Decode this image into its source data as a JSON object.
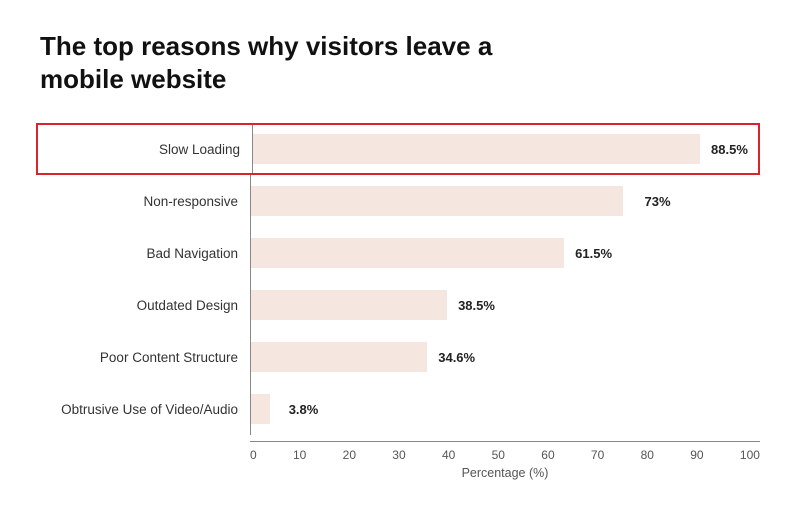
{
  "title": "The top reasons why visitors leave a mobile website",
  "bars": [
    {
      "label": "Slow Loading",
      "value": 88.5,
      "display": "88.5%",
      "highlighted": true
    },
    {
      "label": "Non-responsive",
      "value": 73,
      "display": "73%",
      "highlighted": false
    },
    {
      "label": "Bad Navigation",
      "value": 61.5,
      "display": "61.5%",
      "highlighted": false
    },
    {
      "label": "Outdated Design",
      "value": 38.5,
      "display": "38.5%",
      "highlighted": false
    },
    {
      "label": "Poor Content Structure",
      "value": 34.6,
      "display": "34.6%",
      "highlighted": false
    },
    {
      "label": "Obtrusive Use of Video/Audio",
      "value": 3.8,
      "display": "3.8%",
      "highlighted": false
    }
  ],
  "xAxis": {
    "ticks": [
      "0",
      "10",
      "20",
      "30",
      "40",
      "50",
      "60",
      "70",
      "80",
      "90",
      "100"
    ],
    "title": "Percentage (%)"
  },
  "colors": {
    "bar": "#f5e6df",
    "highlight_border": "#d9232d",
    "axis_line": "#888"
  }
}
